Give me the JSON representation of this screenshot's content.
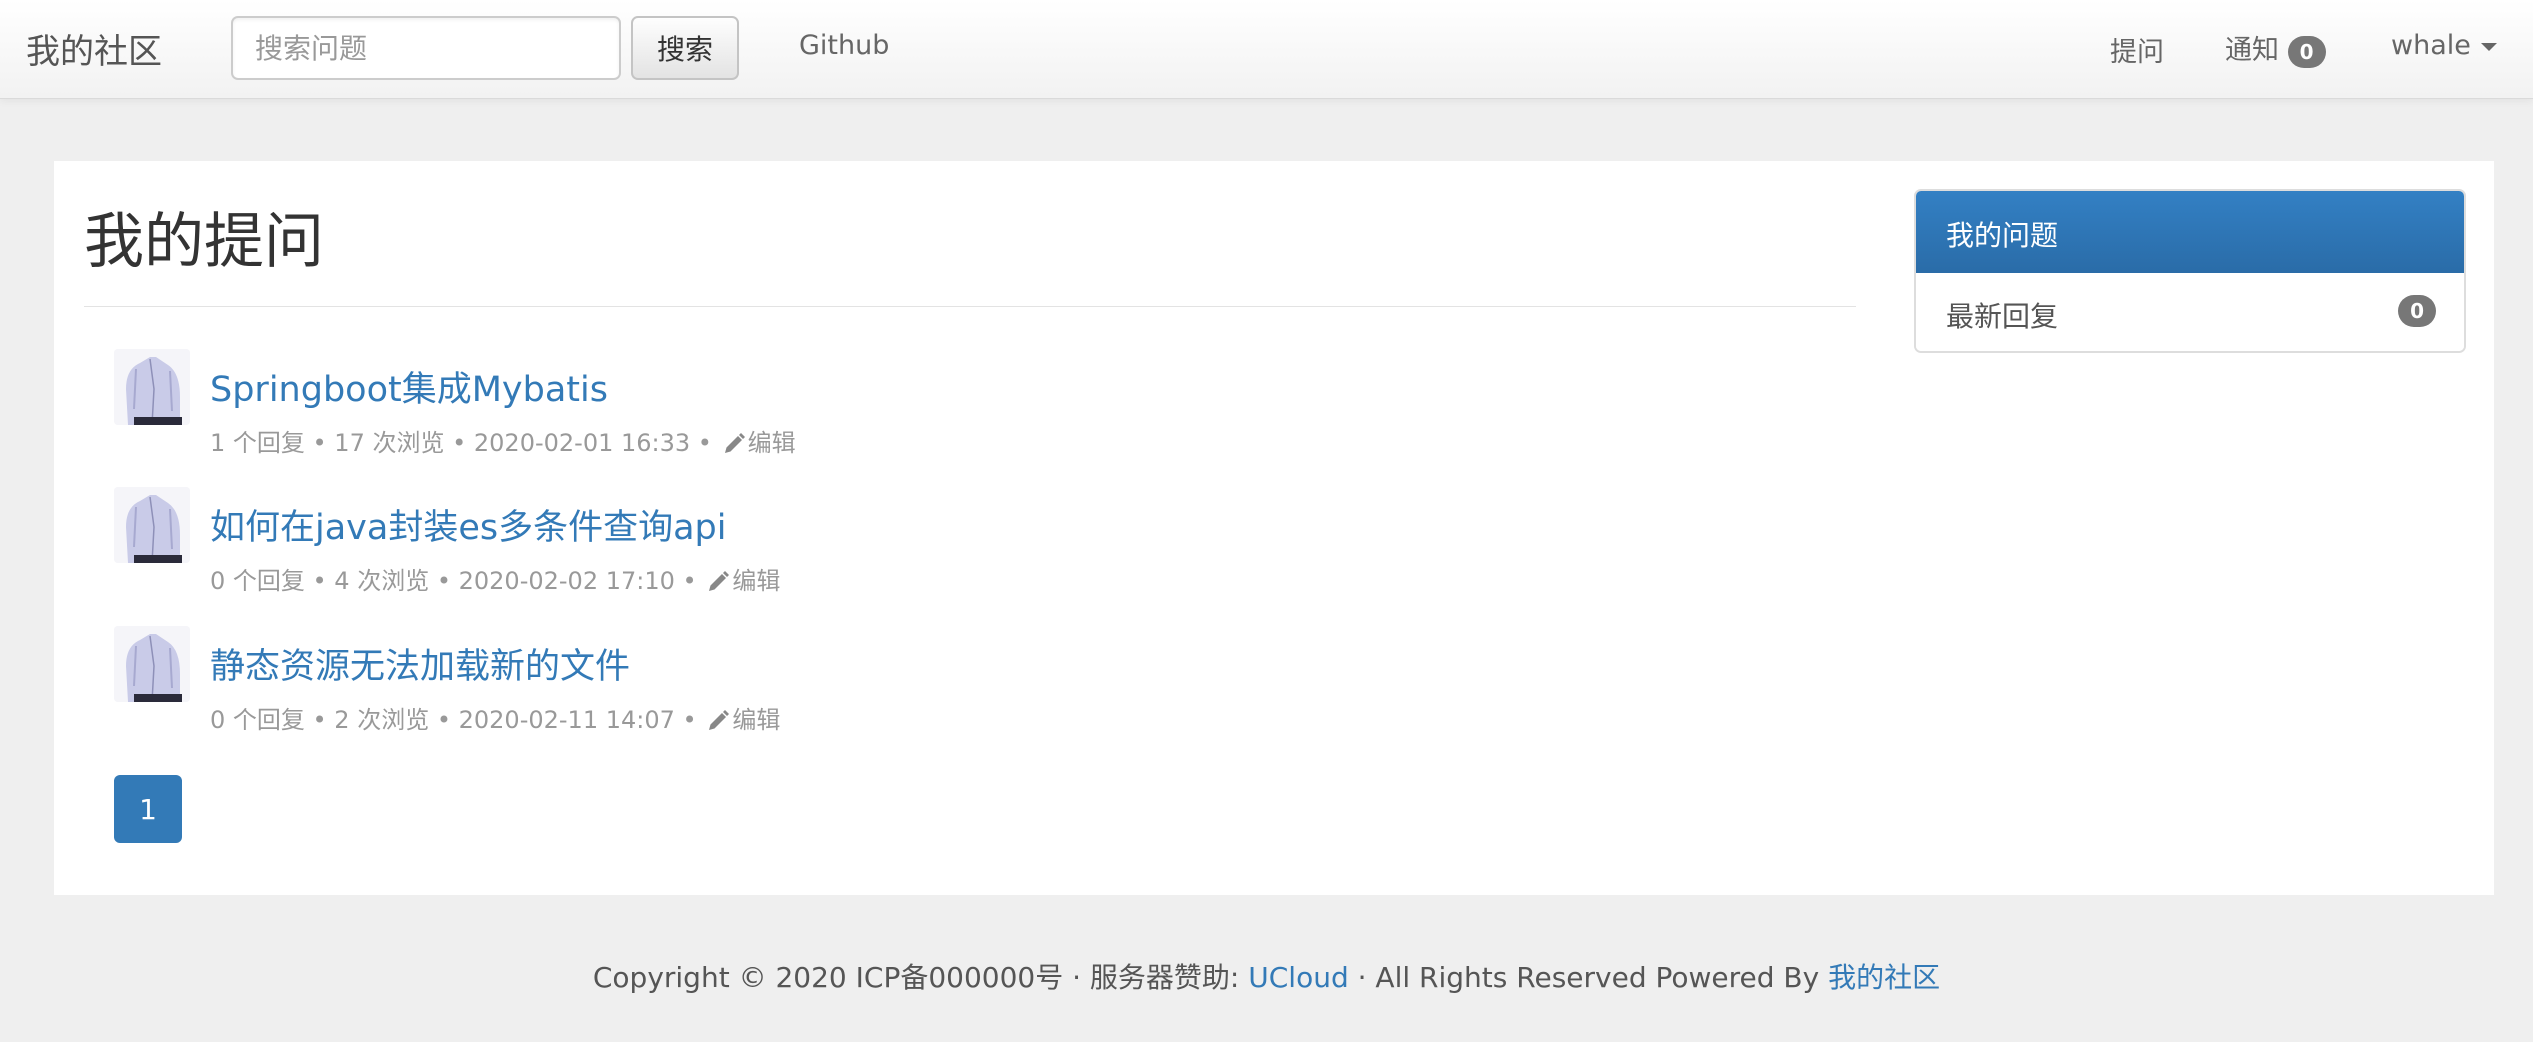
{
  "navbar": {
    "brand": "我的社区",
    "search_placeholder": "搜索问题",
    "search_button": "搜索",
    "github": "Github",
    "ask": "提问",
    "notify_label": "通知",
    "notify_count": "0",
    "user": "whale"
  },
  "main": {
    "title": "我的提问",
    "questions": [
      {
        "title": "Springboot集成Mybatis",
        "meta": "1 个回复 • 17 次浏览 • 2020-02-01 16:33 •",
        "edit": "编辑"
      },
      {
        "title": "如何在java封装es多条件查询api",
        "meta": "0 个回复 • 4 次浏览 • 2020-02-02 17:10 •",
        "edit": "编辑"
      },
      {
        "title": "静态资源无法加载新的文件",
        "meta": "0 个回复 • 2 次浏览 • 2020-02-11 14:07 •",
        "edit": "编辑"
      }
    ],
    "page": "1"
  },
  "side": {
    "active": "我的问题",
    "item": "最新回复",
    "item_count": "0"
  },
  "footer": {
    "prefix": "Copyright © 2020 ICP备000000号 · 服务器赞助: ",
    "sponsor": "UCloud",
    "middle": " · All Rights Reserved Powered By ",
    "site": "我的社区"
  },
  "colors": {
    "link": "#337ab7",
    "active": "#2f77b8",
    "badge": "#777777"
  }
}
